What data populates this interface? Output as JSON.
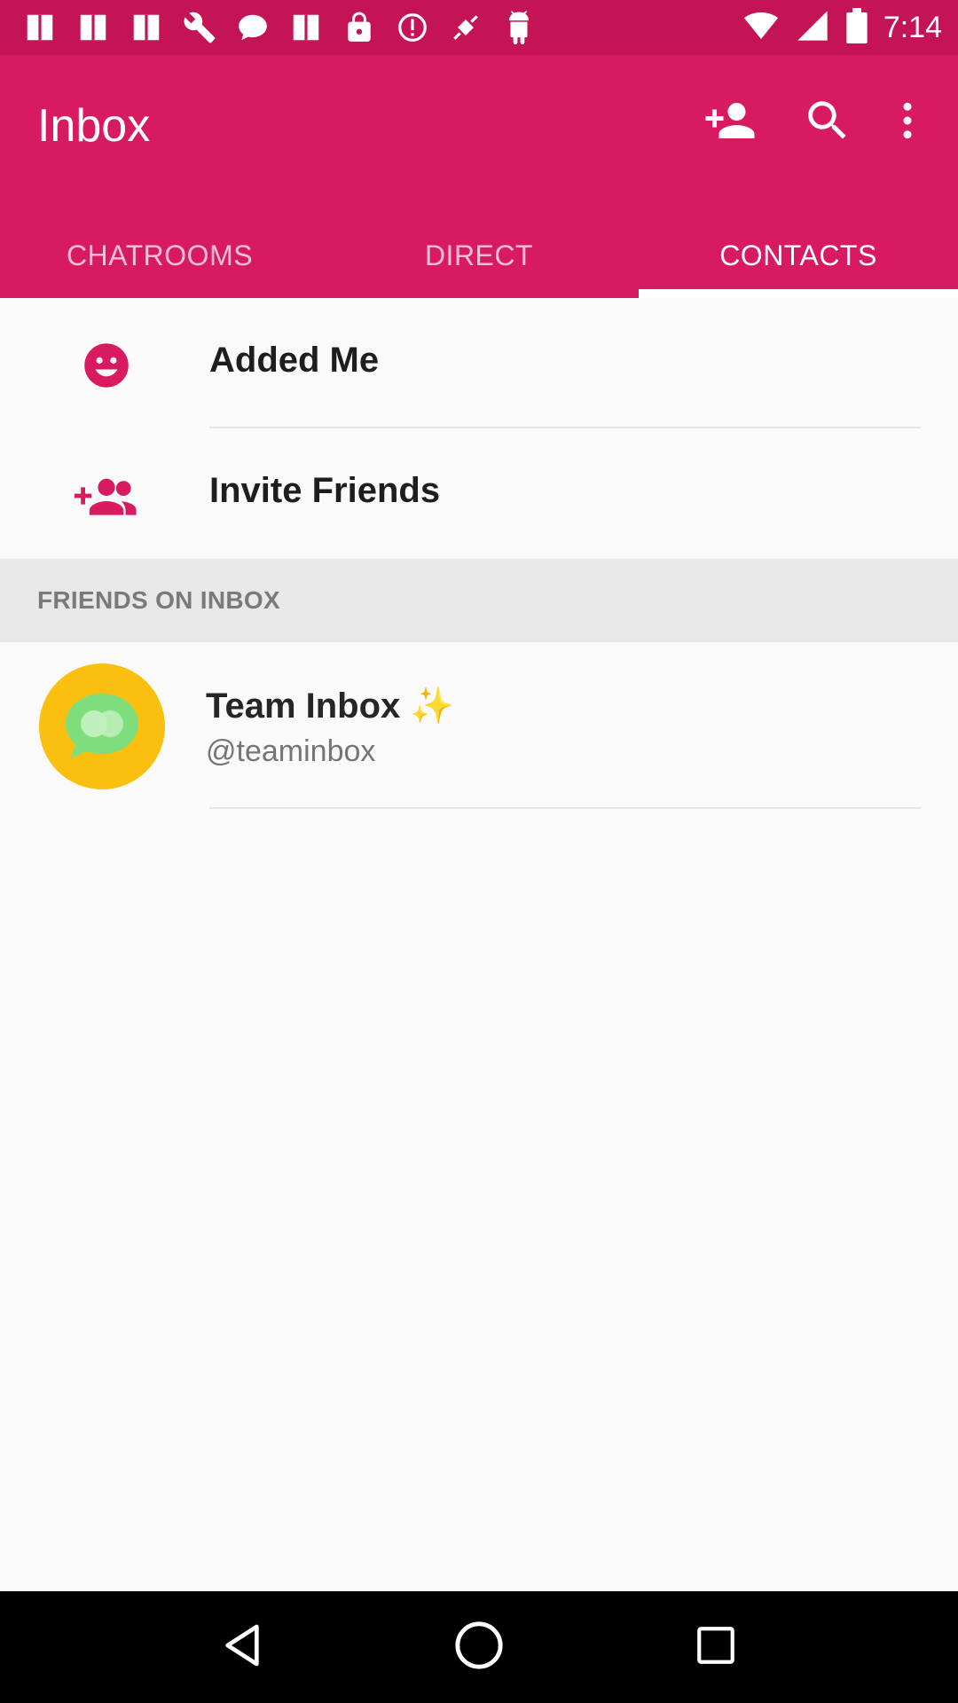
{
  "status_bar": {
    "time": "7:14",
    "left_icons": [
      "notification-icon",
      "notification-icon",
      "notification-icon",
      "wrench-icon",
      "chat-bubble-icon",
      "notification-icon",
      "lock-icon",
      "alert-icon",
      "satellite-icon",
      "android-icon"
    ],
    "right_icons": [
      "wifi-icon",
      "cell-signal-icon",
      "battery-icon"
    ]
  },
  "app_bar": {
    "title": "Inbox",
    "actions": [
      "add-contact-icon",
      "search-icon",
      "more-vert-icon"
    ]
  },
  "tabs": [
    {
      "label": "CHATROOMS",
      "active": false
    },
    {
      "label": "DIRECT",
      "active": false
    },
    {
      "label": "CONTACTS",
      "active": true
    }
  ],
  "list": [
    {
      "label": "Added Me",
      "icon": "smiley-icon"
    },
    {
      "label": "Invite Friends",
      "icon": "group-add-icon"
    }
  ],
  "section": {
    "header": "FRIENDS ON INBOX"
  },
  "friends": [
    {
      "name": "Team Inbox",
      "emoji": "✨",
      "handle": "@teaminbox",
      "avatar": "team-inbox-logo"
    }
  ],
  "colors": {
    "primary": "#d81b60",
    "status_bar": "#c41456",
    "avatar_bg": "#fbbf0f",
    "avatar_bubble": "#7ede7b"
  },
  "nav_bar": [
    "back-icon",
    "home-icon",
    "recents-icon"
  ]
}
